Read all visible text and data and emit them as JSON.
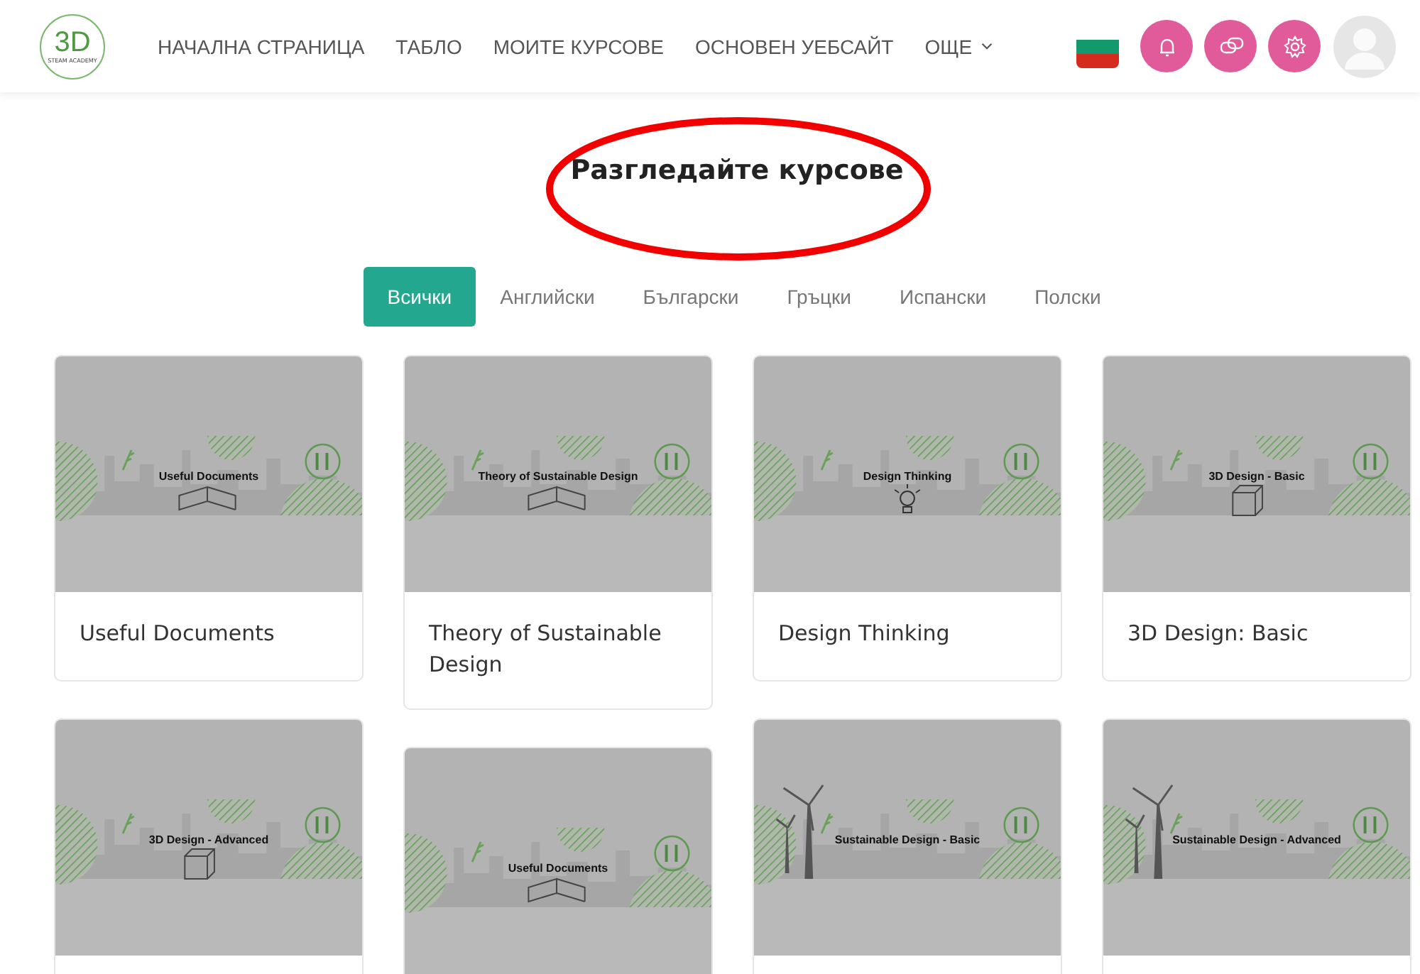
{
  "header": {
    "logo_text": "3D",
    "logo_subtitle": "STEAM ACADEMY",
    "nav": [
      {
        "label": "НАЧАЛНА СТРАНИЦА",
        "dropdown": false
      },
      {
        "label": "ТАБЛО",
        "dropdown": false
      },
      {
        "label": "МОИТЕ КУРСОВЕ",
        "dropdown": false
      },
      {
        "label": "ОСНОВЕН УЕБСАЙТ",
        "dropdown": false
      },
      {
        "label": "ОЩЕ",
        "dropdown": true
      }
    ],
    "actions": [
      {
        "kind": "bell"
      },
      {
        "kind": "chat"
      },
      {
        "kind": "gear"
      }
    ]
  },
  "heading": "Разгледайте курсове",
  "filters": [
    {
      "label": "Всички",
      "selected": true
    },
    {
      "label": "Английски",
      "selected": false
    },
    {
      "label": "Български",
      "selected": false
    },
    {
      "label": "Гръцки",
      "selected": false
    },
    {
      "label": "Испански",
      "selected": false
    },
    {
      "label": "Полски",
      "selected": false
    }
  ],
  "columns": [
    {
      "cards": [
        {
          "banner_text": "Useful Documents",
          "kind": "book",
          "title": "Useful Documents"
        },
        {
          "banner_text": "3D Design - Advanced",
          "kind": "cube"
        }
      ]
    },
    {
      "cards": [
        {
          "banner_text": "Theory of Sustainable Design",
          "kind": "book",
          "title": "Theory of Sustainable Design"
        },
        {
          "banner_text": "Useful Documents",
          "kind": "book"
        }
      ]
    },
    {
      "cards": [
        {
          "banner_text": "Design Thinking",
          "kind": "bulb",
          "title": "Design Thinking"
        },
        {
          "banner_text": "Sustainable Design - Basic",
          "kind": "turbine"
        }
      ]
    },
    {
      "cards": [
        {
          "banner_text": "3D Design - Basic",
          "kind": "cube",
          "title": "3D Design: Basic"
        },
        {
          "banner_text": "Sustainable Design - Advanced",
          "kind": "turbine"
        }
      ]
    }
  ]
}
